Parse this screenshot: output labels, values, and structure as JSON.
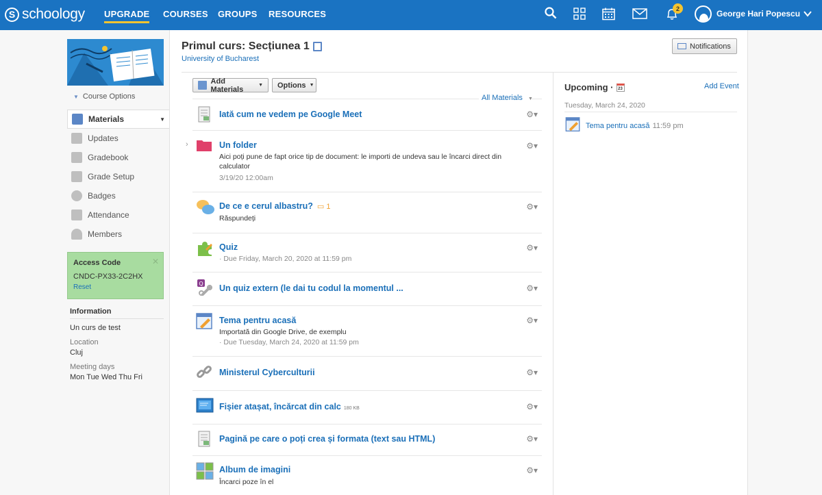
{
  "topbar": {
    "logo": "schoology",
    "nav": [
      "UPGRADE",
      "COURSES",
      "GROUPS",
      "RESOURCES"
    ],
    "notification_count": "2",
    "user_name": "George Hari Popescu",
    "colors": {
      "bar": "#1a73c2",
      "accent": "#f4c430"
    }
  },
  "sidebar": {
    "course_options": "Course Options",
    "items": [
      {
        "label": "Materials",
        "icon": "materials-icon",
        "active": true
      },
      {
        "label": "Updates",
        "icon": "updates-icon"
      },
      {
        "label": "Gradebook",
        "icon": "gradebook-icon"
      },
      {
        "label": "Grade Setup",
        "icon": "grade-setup-icon"
      },
      {
        "label": "Badges",
        "icon": "badges-icon"
      },
      {
        "label": "Attendance",
        "icon": "attendance-icon"
      },
      {
        "label": "Members",
        "icon": "members-icon"
      }
    ],
    "access_code": {
      "title": "Access Code",
      "code": "CNDC-PX33-2C2HX",
      "reset": "Reset"
    },
    "information": {
      "title": "Information",
      "course_name": "Un curs de test",
      "location_label": "Location",
      "location": "Cluj",
      "meeting_label": "Meeting days",
      "meeting_days": "Mon Tue Wed Thu Fri"
    }
  },
  "header": {
    "title": "Primul curs: Secțiunea 1",
    "subtitle": "University of Bucharest",
    "notifications_button": "Notifications"
  },
  "toolbar": {
    "add_materials": "Add Materials",
    "options": "Options",
    "all_materials": "All Materials"
  },
  "materials": [
    {
      "title": "Iată cum ne vedem pe Google Meet",
      "icon": "page-icon"
    },
    {
      "title": "Un folder",
      "icon": "folder-icon",
      "desc": "Aici poți pune de fapt orice tip de document: le importi de undeva sau le încarci direct din calculator",
      "meta": "3/19/20 12:00am"
    },
    {
      "title": "De ce e cerul albastru?",
      "icon": "discussion-icon",
      "comments": "1",
      "desc": "Răspundeți"
    },
    {
      "title": "Quiz",
      "icon": "quiz-icon",
      "meta": "· Due Friday, March 20, 2020 at 11:59 pm"
    },
    {
      "title": "Un quiz extern (le dai tu codul la momentul ...",
      "icon": "external-tool-icon"
    },
    {
      "title": "Tema pentru acasă",
      "icon": "assignment-icon",
      "desc": "Importată din Google Drive, de exemplu",
      "meta": "· Due Tuesday, March 24, 2020 at 11:59 pm"
    },
    {
      "title": "Ministerul Cyberculturii",
      "icon": "link-icon"
    },
    {
      "title": "Fișier atașat, încărcat din calc",
      "icon": "file-icon",
      "size": "180 KB"
    },
    {
      "title": "Pagină pe care o poți crea și formata (text sau HTML)",
      "icon": "page-icon"
    },
    {
      "title": "Album de imagini",
      "icon": "album-icon",
      "desc": "Încarci poze în el"
    }
  ],
  "upcoming": {
    "title": "Upcoming ·",
    "calendar_day": "23",
    "add_event": "Add Event",
    "date": "Tuesday, March 24, 2020",
    "item": "Tema pentru acasă",
    "time": "11:59 pm"
  }
}
